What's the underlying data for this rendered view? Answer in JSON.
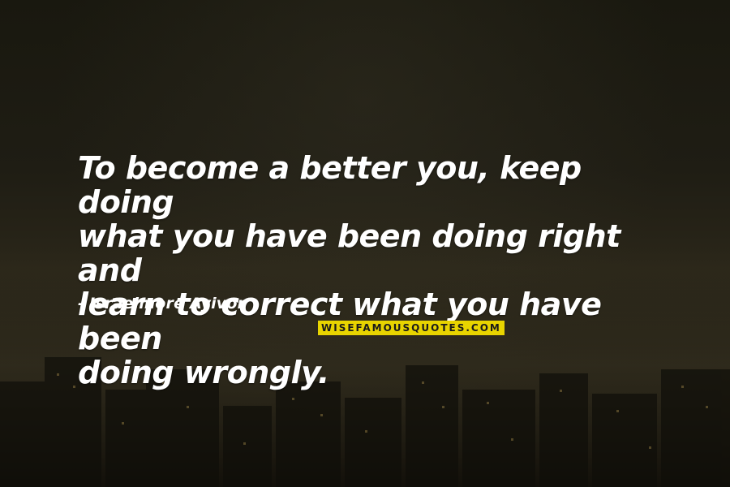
{
  "quote": {
    "text": "To become a better you, keep doing\nwhat you have been doing right and\nlearn to correct what you have been\ndoing wrongly.",
    "author_dash": "-",
    "author": "Israelmore Ayivor"
  },
  "brand": {
    "label": "WISEFAMOUSQUOTES.COM"
  },
  "colors": {
    "text": "#ffffff",
    "brand_bg": "#e8d400",
    "background": "#1b1a13"
  }
}
